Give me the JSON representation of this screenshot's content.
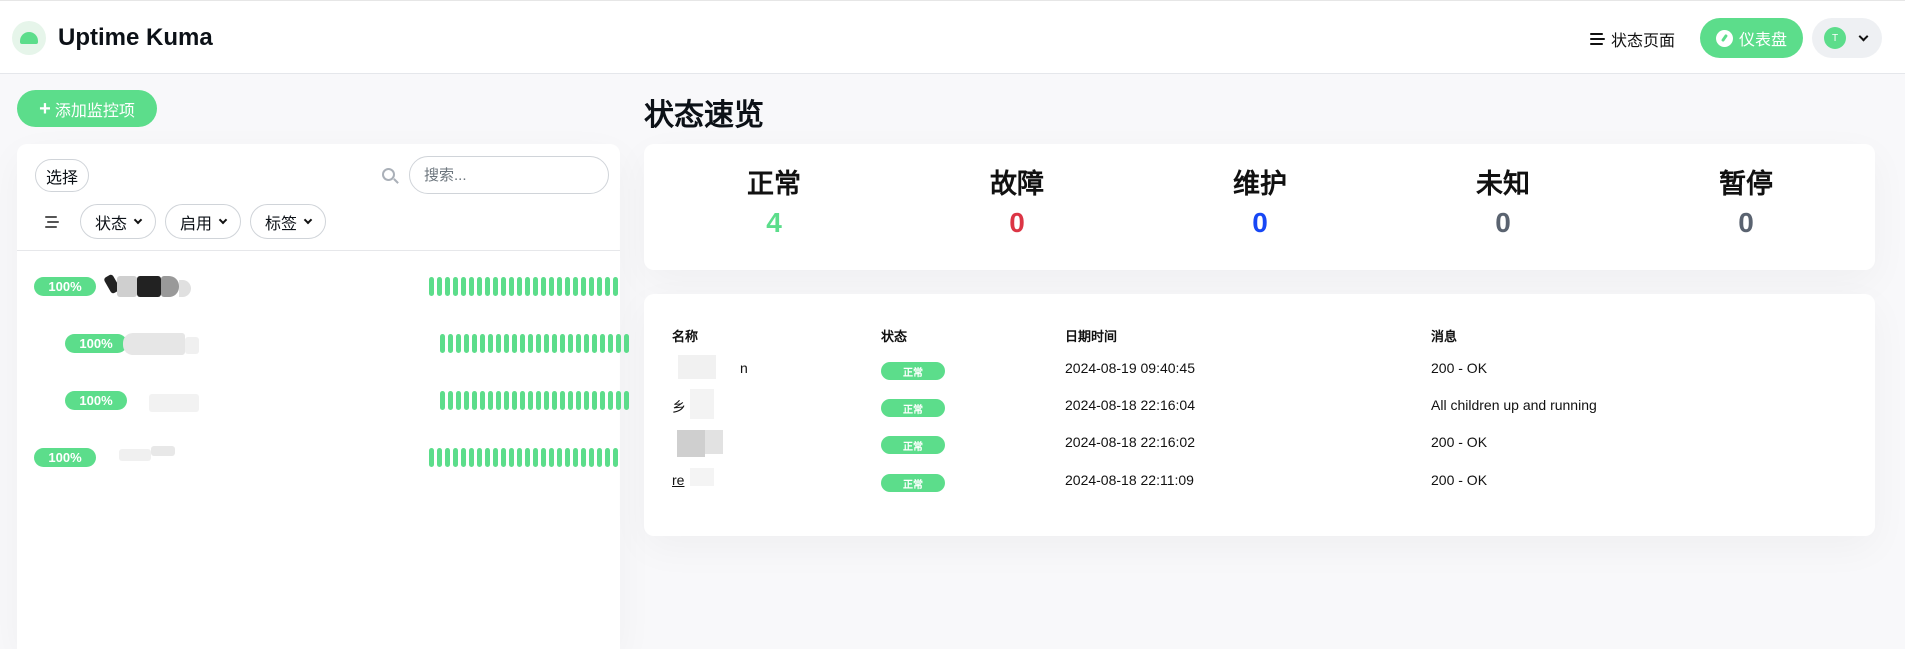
{
  "header": {
    "app_title": "Uptime Kuma",
    "status_page_label": "状态页面",
    "dashboard_label": "仪表盘",
    "avatar_letter": "T"
  },
  "left": {
    "add_button": "添加监控项",
    "select_button": "选择",
    "search_placeholder": "搜索...",
    "filters": [
      "状态",
      "启用",
      "标签"
    ],
    "monitors": [
      {
        "uptime": "100%"
      },
      {
        "uptime": "100%"
      },
      {
        "uptime": "100%"
      },
      {
        "uptime": "100%"
      }
    ]
  },
  "overview": {
    "title": "状态速览",
    "stats": [
      {
        "label": "正常",
        "value": "4",
        "color": "#5cdd8b"
      },
      {
        "label": "故障",
        "value": "0",
        "color": "#dc3545"
      },
      {
        "label": "维护",
        "value": "0",
        "color": "#1747f5"
      },
      {
        "label": "未知",
        "value": "0",
        "color": "#5a6370"
      },
      {
        "label": "暂停",
        "value": "0",
        "color": "#5a6370"
      }
    ]
  },
  "events": {
    "columns": [
      "名称",
      "状态",
      "日期时间",
      "消息"
    ],
    "rows": [
      {
        "name": "n",
        "status": "正常",
        "datetime": "2024-08-19 09:40:45",
        "message": "200 - OK"
      },
      {
        "name": "乡",
        "status": "正常",
        "datetime": "2024-08-18 22:16:04",
        "message": "All children up and running"
      },
      {
        "name": "",
        "status": "正常",
        "datetime": "2024-08-18 22:16:02",
        "message": "200 - OK"
      },
      {
        "name": "re",
        "status": "正常",
        "datetime": "2024-08-18 22:11:09",
        "message": "200 - OK"
      }
    ]
  },
  "colors": {
    "primary": "#5cdd8b",
    "danger": "#dc3545",
    "maintenance": "#1747f5",
    "muted": "#5a6370"
  }
}
